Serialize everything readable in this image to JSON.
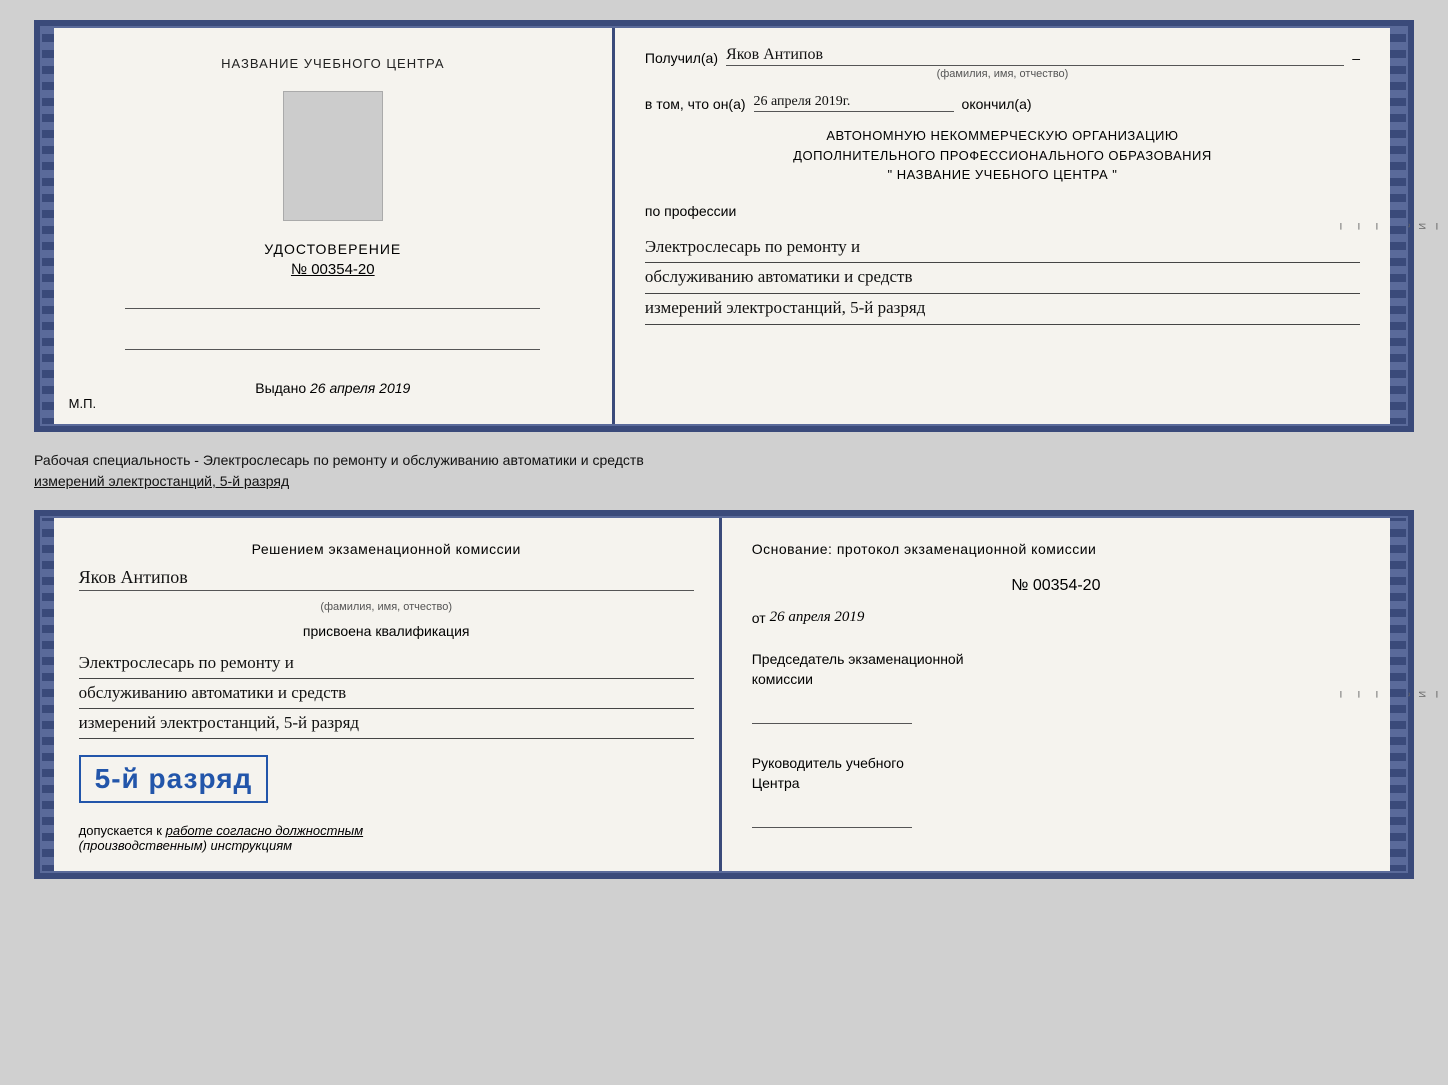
{
  "top_cert": {
    "left": {
      "org_name": "НАЗВАНИЕ УЧЕБНОГО ЦЕНТРА",
      "udost_label": "УДОСТОВЕРЕНИЕ",
      "udost_number": "№ 00354-20",
      "vydano_prefix": "Выдано",
      "vydano_date": "26 апреля 2019",
      "mp_label": "М.П."
    },
    "right": {
      "poluchil_label": "Получил(а)",
      "poluchil_value": "Яков Антипов",
      "fio_sub": "(фамилия, имя, отчество)",
      "vtom_prefix": "в том, что он(а)",
      "vtom_date": "26 апреля 2019г.",
      "okončil_label": "окончил(а)",
      "org_line1": "АВТОНОМНУЮ НЕКОММЕРЧЕСКУЮ ОРГАНИЗАЦИЮ",
      "org_line2": "ДОПОЛНИТЕЛЬНОГО ПРОФЕССИОНАЛЬНОГО ОБРАЗОВАНИЯ",
      "org_line3": "\"   НАЗВАНИЕ УЧЕБНОГО ЦЕНТРА   \"",
      "po_professii": "по профессии",
      "profession_line1": "Электрослесарь по ремонту и",
      "profession_line2": "обслуживанию автоматики и средств",
      "profession_line3": "измерений электростанций, 5-й разряд"
    }
  },
  "description": {
    "line1": "Рабочая специальность - Электрослесарь по ремонту и обслуживанию автоматики и средств",
    "line2": "измерений электростанций, 5-й разряд"
  },
  "bottom_cert": {
    "left": {
      "resheniye": "Решением экзаменационной комиссии",
      "name_value": "Яков Антипов",
      "fio_sub": "(фамилия, имя, отчество)",
      "prisvoena": "присвоена квалификация",
      "qual_line1": "Электрослесарь по ремонту и",
      "qual_line2": "обслуживанию автоматики и средств",
      "qual_line3": "измерений электростанций, 5-й разряд",
      "razryad_badge": "5-й разряд",
      "dopusk_prefix": "допускается к",
      "dopusk_value": "работе согласно должностным",
      "dopusk_line2": "(производственным) инструкциям"
    },
    "right": {
      "osnovaniye": "Основание: протокол экзаменационной комиссии",
      "number_label": "№ 00354-20",
      "ot_prefix": "от",
      "ot_date": "26 апреля 2019",
      "chairman_line1": "Председатель экзаменационной",
      "chairman_line2": "комиссии",
      "rukovoditel_line1": "Руководитель учебного",
      "rukovoditel_line2": "Центра"
    }
  }
}
